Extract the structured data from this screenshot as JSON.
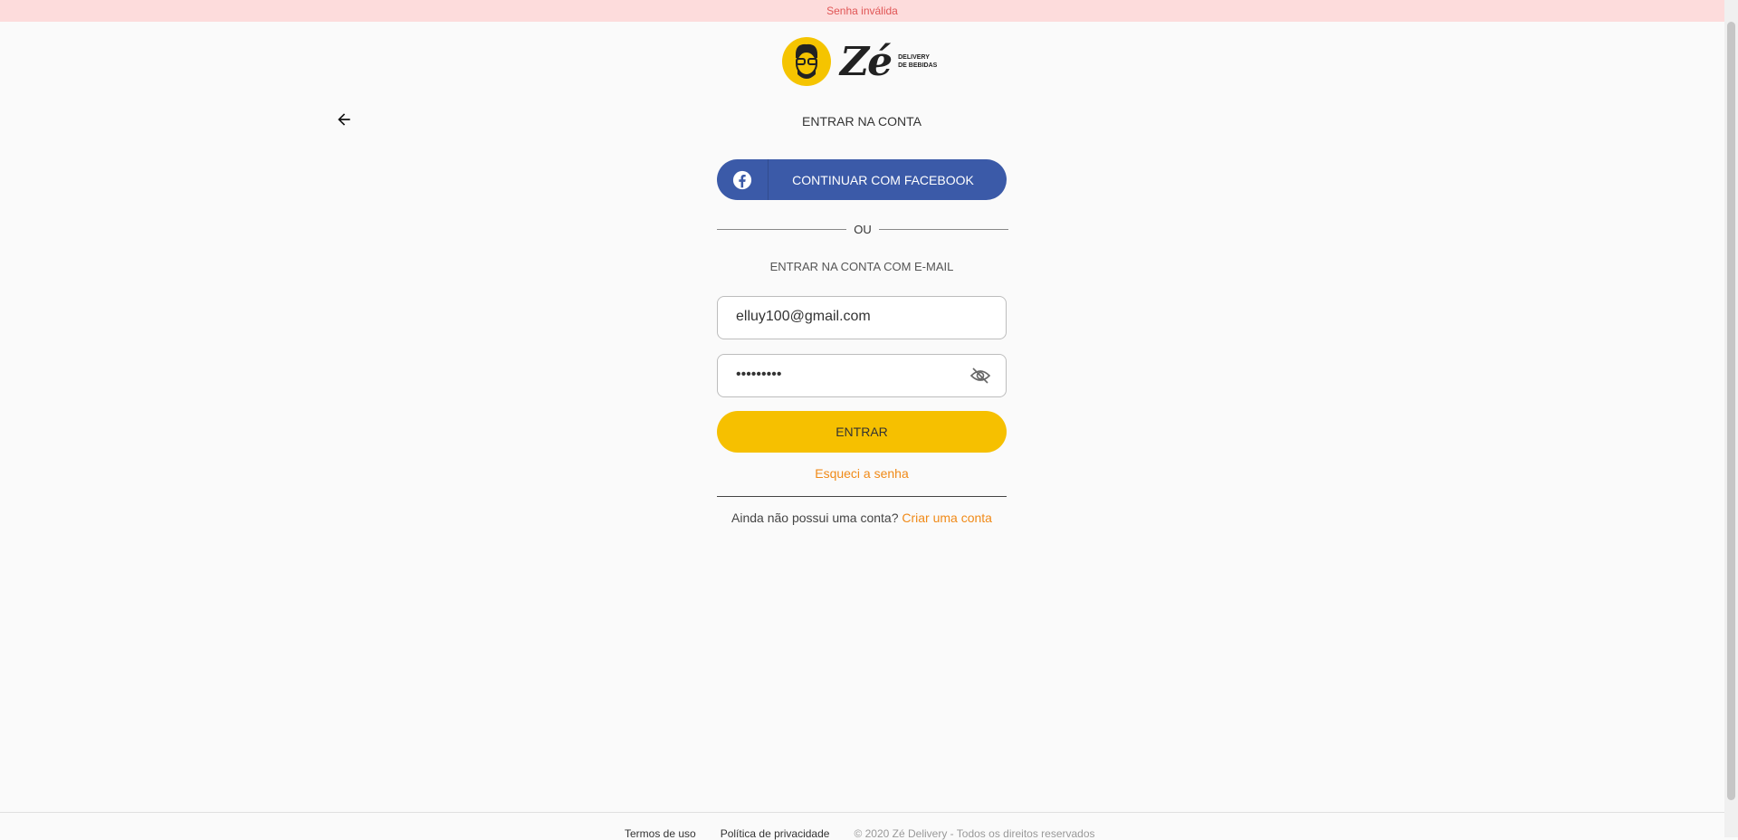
{
  "banner": {
    "message": "Senha inválida"
  },
  "logo": {
    "wordmark": "Zé",
    "subtitle_line1": "DELIVERY",
    "subtitle_line2": "DE BEBIDAS"
  },
  "header": {
    "title": "ENTRAR NA CONTA"
  },
  "facebook": {
    "label": "CONTINUAR COM FACEBOOK",
    "color": "#3b5aa8"
  },
  "divider": {
    "text": "OU"
  },
  "email_section": {
    "heading": "ENTRAR NA CONTA COM E-MAIL"
  },
  "form": {
    "email_value": "elluy100@gmail.com",
    "password_value": "•••••••••"
  },
  "actions": {
    "enter_label": "ENTRAR",
    "enter_color": "#f6c000",
    "forgot_label": "Esqueci a senha",
    "signup_prompt": "Ainda não possui uma conta?",
    "signup_link": "Criar uma conta",
    "link_color": "#f08a18"
  },
  "footer": {
    "terms": "Termos de uso",
    "privacy": "Política de privacidade",
    "copyright": "© 2020 Zé Delivery - Todos os direitos reservados"
  },
  "icons": {
    "back": "arrow-left-icon",
    "facebook": "facebook-icon",
    "visibility": "eye-off-icon"
  }
}
